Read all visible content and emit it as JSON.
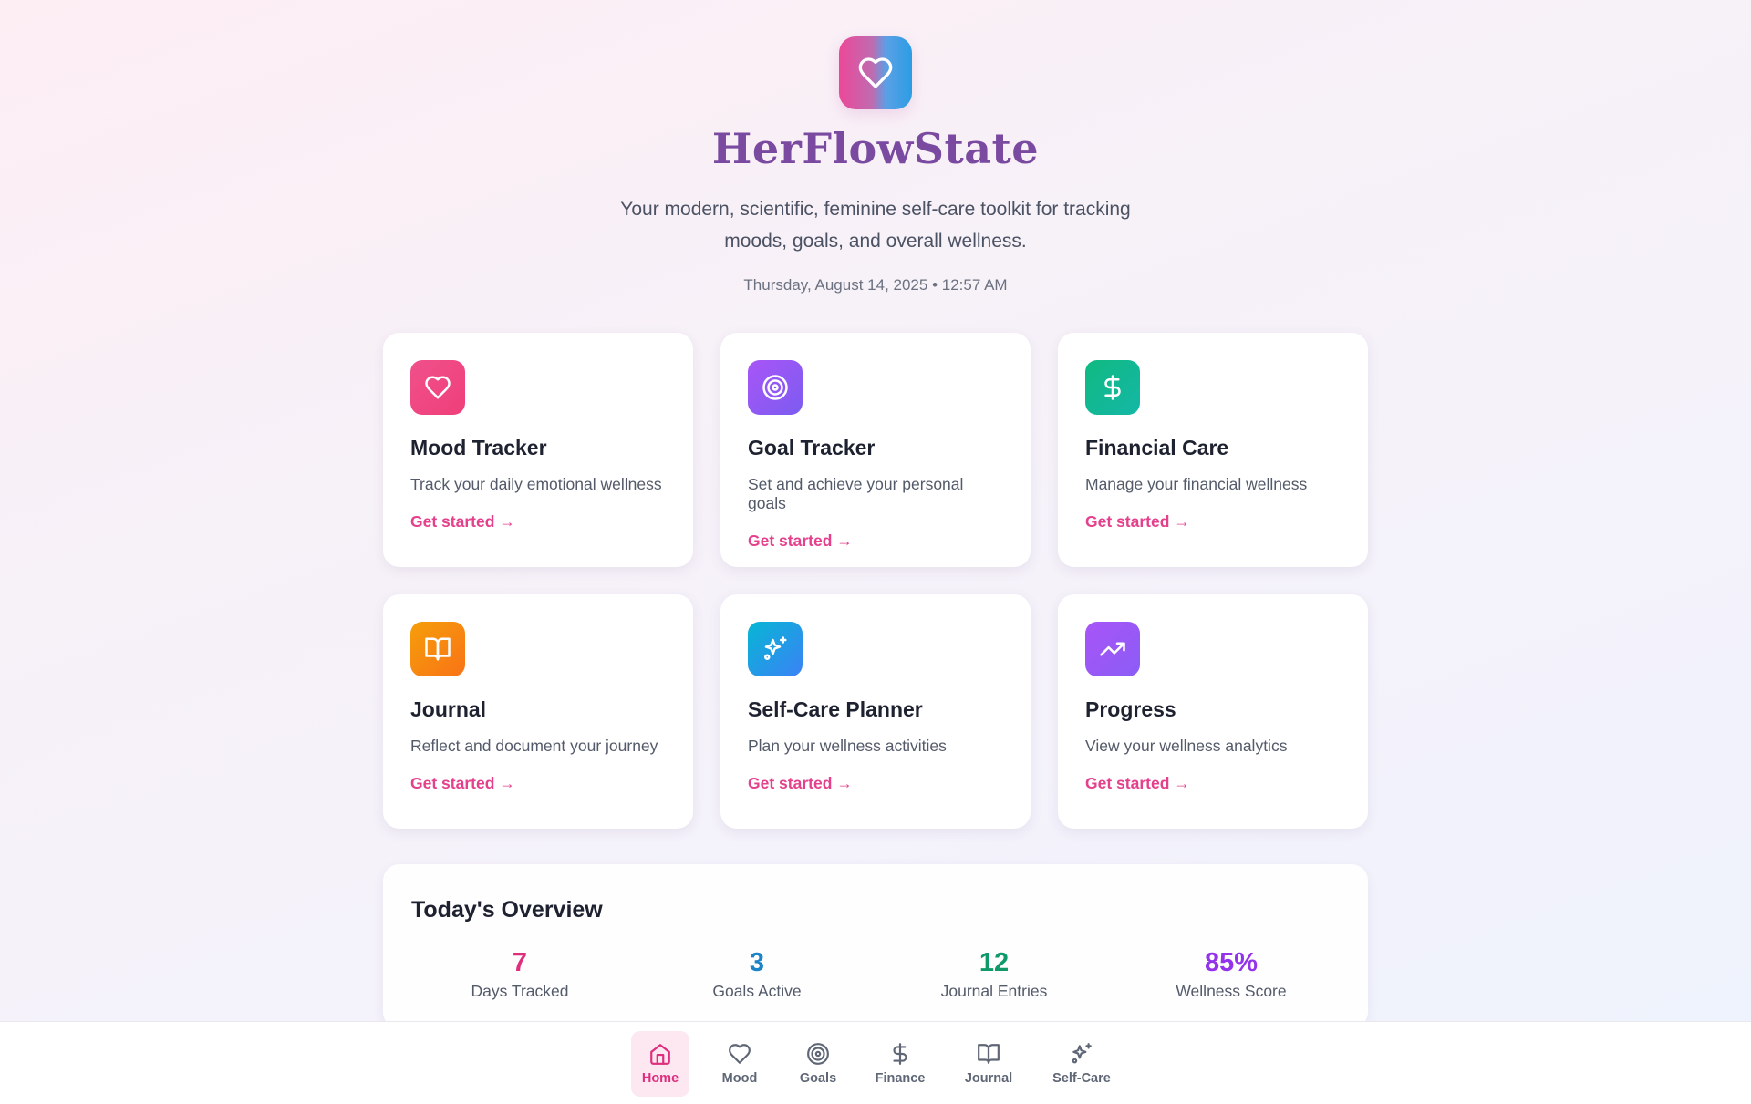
{
  "app": {
    "name": "HerFlowState",
    "tagline": "Your modern, scientific, feminine self-care toolkit for tracking moods, goals, and overall wellness.",
    "datetime": "Thursday, August 14, 2025 • 12:57 AM"
  },
  "cards": [
    {
      "title": "Mood Tracker",
      "description": "Track your daily emotional wellness",
      "cta": "Get started →",
      "icon": "heart-icon",
      "color_from": "#f0508a",
      "color_to": "#ef3f7a"
    },
    {
      "title": "Goal Tracker",
      "description": "Set and achieve your personal goals",
      "cta": "Get started →",
      "icon": "target-icon",
      "color_from": "#a855f7",
      "color_to": "#7c5cf0"
    },
    {
      "title": "Financial Care",
      "description": "Manage your financial wellness",
      "cta": "Get started →",
      "icon": "dollar-icon",
      "color_from": "#10b981",
      "color_to": "#14b8a6"
    },
    {
      "title": "Journal",
      "description": "Reflect and document your journey",
      "cta": "Get started →",
      "icon": "book-icon",
      "color_from": "#f59e0b",
      "color_to": "#f97316"
    },
    {
      "title": "Self-Care Planner",
      "description": "Plan your wellness activities",
      "cta": "Get started →",
      "icon": "sparkles-icon",
      "color_from": "#06b6d4",
      "color_to": "#3b82f6"
    },
    {
      "title": "Progress",
      "description": "View your wellness analytics",
      "cta": "Get started →",
      "icon": "trending-up-icon",
      "color_from": "#a855f7",
      "color_to": "#8b5cf6"
    }
  ],
  "overview": {
    "title": "Today's Overview",
    "stats": [
      {
        "value": "7",
        "label": "Days Tracked",
        "color": "#de2e7d"
      },
      {
        "value": "3",
        "label": "Goals Active",
        "color": "#1d83c7"
      },
      {
        "value": "12",
        "label": "Journal Entries",
        "color": "#109a6a"
      },
      {
        "value": "85%",
        "label": "Wellness Score",
        "color": "#9333ea"
      }
    ]
  },
  "nav": [
    {
      "label": "Home",
      "icon": "home-icon",
      "active": true
    },
    {
      "label": "Mood",
      "icon": "heart-icon",
      "active": false
    },
    {
      "label": "Goals",
      "icon": "target-icon",
      "active": false
    },
    {
      "label": "Finance",
      "icon": "dollar-icon",
      "active": false
    },
    {
      "label": "Journal",
      "icon": "book-icon",
      "active": false
    },
    {
      "label": "Self-Care",
      "icon": "sparkles-icon",
      "active": false
    }
  ]
}
